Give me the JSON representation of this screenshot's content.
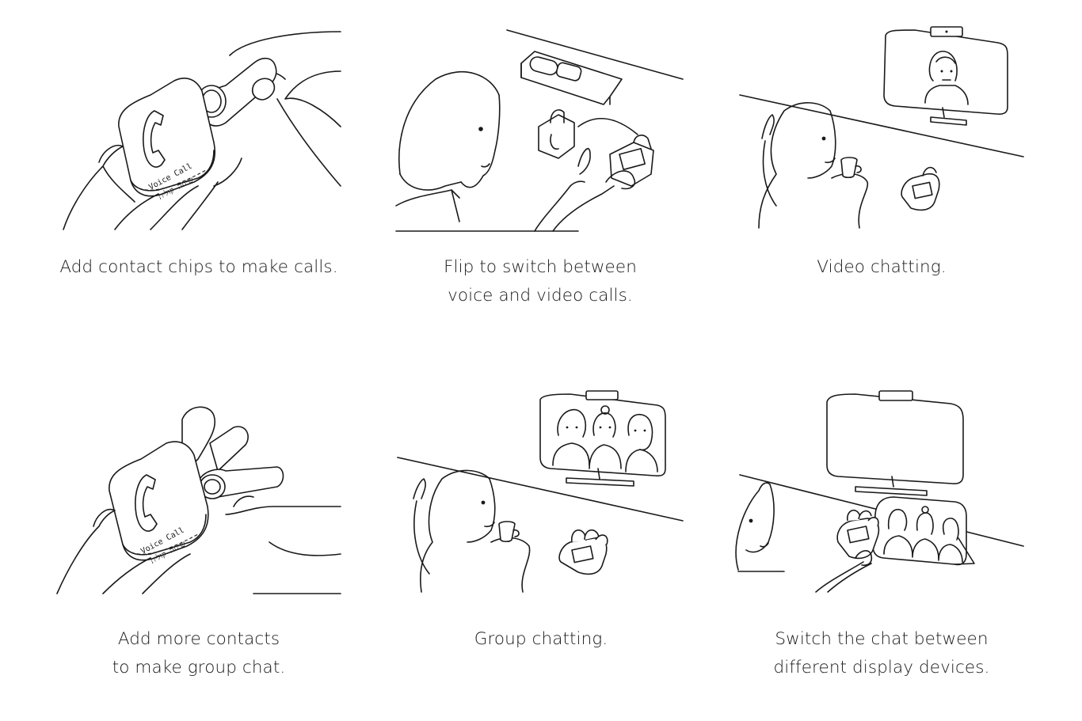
{
  "panels": [
    {
      "caption": [
        "Add contact chips to make calls."
      ],
      "device_label": [
        "Voice Call",
        "שיחה קולית"
      ]
    },
    {
      "caption": [
        "Flip to switch between",
        "voice and video calls."
      ]
    },
    {
      "caption": [
        "Video chatting."
      ]
    },
    {
      "caption": [
        "Add more contacts",
        "to make group chat."
      ],
      "device_label": [
        "Voice Call",
        "שיחה קולית"
      ]
    },
    {
      "caption": [
        "Group chatting."
      ]
    },
    {
      "caption": [
        "Switch the chat between",
        "different display devices."
      ]
    }
  ]
}
